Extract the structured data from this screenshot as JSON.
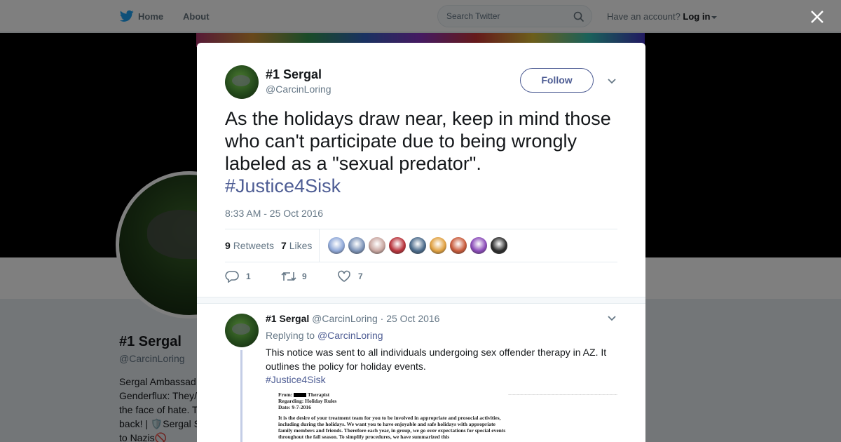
{
  "nav": {
    "home": "Home",
    "about": "About",
    "search_placeholder": "Search Twitter",
    "account_prompt": "Have an account?",
    "login": "Log in"
  },
  "profile": {
    "name": "#1 Sergal",
    "handle": "@CarcinLoring",
    "bio_lines": [
      "Sergal Ambassad",
      "Genderflux: They/",
      "the face of hate. T",
      "back! | 🛡️Sergal S",
      "to Nazis🚫"
    ]
  },
  "tweet": {
    "name": "#1 Sergal",
    "handle": "@CarcinLoring",
    "follow_label": "Follow",
    "text": "As the holidays draw near, keep in mind those who can't participate due to being wrongly labeled as a \"sexual predator\".",
    "hashtag": "#Justice4Sisk",
    "timestamp": "8:33 AM - 25 Oct 2016",
    "retweets_count": "9",
    "retweets_label": "Retweets",
    "likes_count": "7",
    "likes_label": "Likes",
    "reply_count": "1",
    "retweet_count": "9",
    "like_count": "7",
    "liker_colors": [
      "#8fa8d8",
      "#7c93b8",
      "#c9a6a0",
      "#b8323a",
      "#4a6a8a",
      "#e0a040",
      "#c85a3a",
      "#8a4ab8",
      "#2a2a2a"
    ]
  },
  "reply": {
    "name": "#1 Sergal",
    "handle": "@CarcinLoring",
    "date": "· 25 Oct 2016",
    "replying_prefix": "Replying to",
    "replying_to": "@CarcinLoring",
    "text": "This notice was sent to all individuals undergoing sex offender therapy in AZ. It outlines the policy for holiday events.",
    "hashtag": "#Justice4Sisk",
    "doc": {
      "from": "From:",
      "from_role": "Therapist",
      "regarding": "Regarding: Holiday Rules",
      "date": "Date: 9-7-2016",
      "body": "It is the desire of your treatment team for you to be involved in appropriate and prosocial activities, including during the holidays. We want you to have enjoyable and safe holidays with appropriate family members and friends. Therefore each year, in group, we go over expectations for special events throughout the fall season. To simplify procedures, we have summarized this"
    }
  }
}
